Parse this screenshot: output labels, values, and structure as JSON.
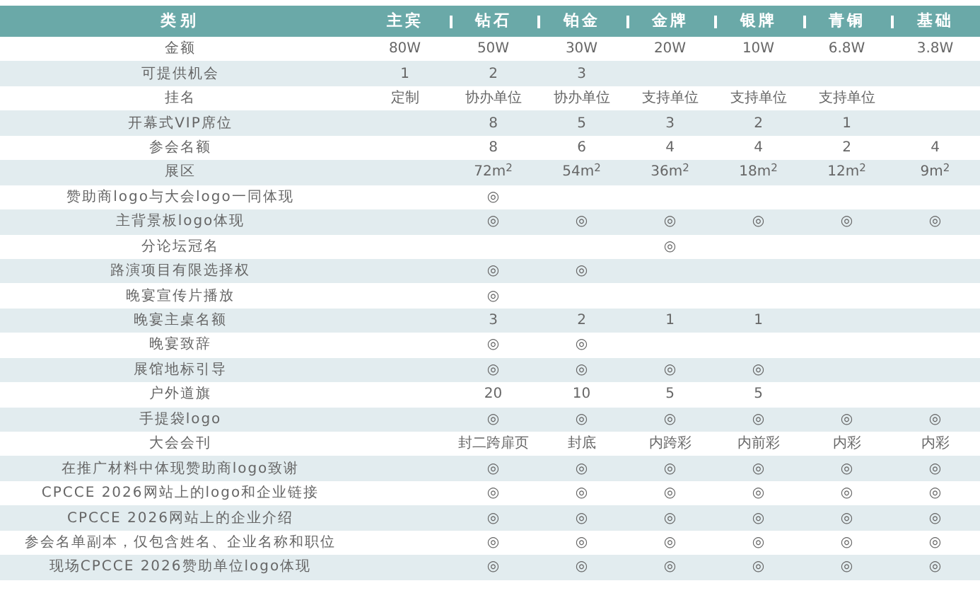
{
  "table": {
    "columns": [
      "类别",
      "主宾",
      "钻石",
      "铂金",
      "金牌",
      "银牌",
      "青铜",
      "基础"
    ],
    "rows": [
      {
        "cells": [
          "金额",
          "80W",
          "50W",
          "30W",
          "20W",
          "10W",
          "6.8W",
          "3.8W"
        ]
      },
      {
        "cells": [
          "可提供机会",
          "1",
          "2",
          "3",
          "",
          "",
          "",
          ""
        ]
      },
      {
        "cells": [
          "挂名",
          "定制",
          "协办单位",
          "协办单位",
          "支持单位",
          "支持单位",
          "支持单位",
          ""
        ]
      },
      {
        "cells": [
          "开幕式VIP席位",
          "",
          "8",
          "5",
          "3",
          "2",
          "1",
          ""
        ]
      },
      {
        "cells": [
          "参会名额",
          "",
          "8",
          "6",
          "4",
          "4",
          "2",
          "4"
        ]
      },
      {
        "cells": [
          "展区",
          "",
          "72m$^{2}$",
          "54m$^{2}$",
          "36m$^{2}$",
          "18m$^{2}$",
          "12m$^{2}$",
          "9m$^{2}$"
        ]
      },
      {
        "cells": [
          "赞助商logo与大会logo一同体现",
          "",
          "◎",
          "",
          "",
          "",
          "",
          ""
        ]
      },
      {
        "cells": [
          "主背景板logo体现",
          "",
          "◎",
          "◎",
          "◎",
          "◎",
          "◎",
          "◎"
        ]
      },
      {
        "cells": [
          "分论坛冠名",
          "",
          "",
          "",
          "◎",
          "",
          "",
          ""
        ]
      },
      {
        "cells": [
          "路演项目有限选择权",
          "",
          "◎",
          "◎",
          "",
          "",
          "",
          ""
        ]
      },
      {
        "cells": [
          "晚宴宣传片播放",
          "",
          "◎",
          "",
          "",
          "",
          "",
          ""
        ]
      },
      {
        "cells": [
          "晚宴主桌名额",
          "",
          "3",
          "2",
          "1",
          "1",
          "",
          ""
        ]
      },
      {
        "cells": [
          "晚宴致辞",
          "",
          "◎",
          "◎",
          "",
          "",
          "",
          ""
        ]
      },
      {
        "cells": [
          "展馆地标引导",
          "",
          "◎",
          "◎",
          "◎",
          "◎",
          "",
          ""
        ]
      },
      {
        "cells": [
          "户外道旗",
          "",
          "20",
          "10",
          "5",
          "5",
          "",
          ""
        ]
      },
      {
        "cells": [
          "手提袋logo",
          "",
          "◎",
          "◎",
          "◎",
          "◎",
          "◎",
          "◎"
        ]
      },
      {
        "cells": [
          "大会会刊",
          "",
          "封二跨扉页",
          "封底",
          "内跨彩",
          "内前彩",
          "内彩",
          "内彩"
        ]
      },
      {
        "cells": [
          "在推广材料中体现赞助商logo致谢",
          "",
          "◎",
          "◎",
          "◎",
          "◎",
          "◎",
          "◎"
        ]
      },
      {
        "cells": [
          "CPCCE 2026网站上的logo和企业链接",
          "",
          "◎",
          "◎",
          "◎",
          "◎",
          "◎",
          "◎"
        ]
      },
      {
        "cells": [
          "CPCCE 2026网站上的企业介绍",
          "",
          "◎",
          "◎",
          "◎",
          "◎",
          "◎",
          "◎"
        ]
      },
      {
        "cells": [
          "参会名单副本，仅包含姓名、企业名称和职位",
          "",
          "◎",
          "◎",
          "◎",
          "◎",
          "◎",
          "◎"
        ]
      },
      {
        "cells": [
          "现场CPCCE 2026赞助单位logo体现",
          "",
          "◎",
          "◎",
          "◎",
          "◎",
          "◎",
          "◎"
        ]
      }
    ]
  }
}
